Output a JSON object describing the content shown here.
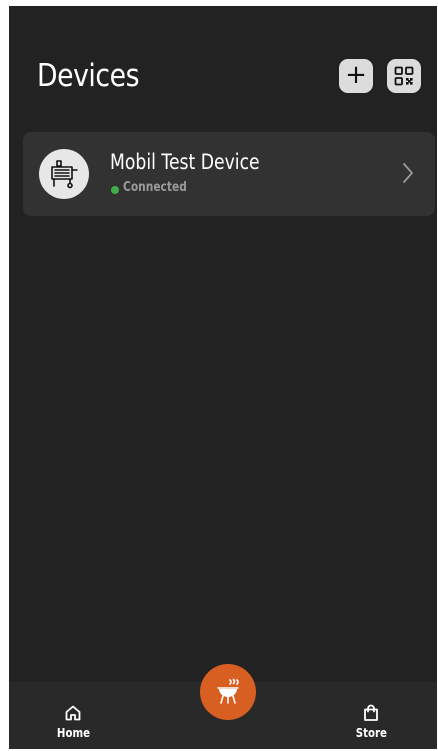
{
  "header": {
    "title": "Devices",
    "add_label": "+",
    "add_icon": "plus-icon",
    "qr_icon": "qr-code-icon"
  },
  "devices": [
    {
      "name": "Mobil Test Device",
      "status": "Connected",
      "status_color": "#3fae4a",
      "icon": "grill-device-icon"
    }
  ],
  "bottom_nav": {
    "home_label": "Home",
    "home_icon": "home-icon",
    "store_label": "Store",
    "store_icon": "shopping-bag-icon",
    "center_icon": "grill-icon"
  },
  "colors": {
    "background": "#222222",
    "card": "#323232",
    "accent": "#d85f22",
    "nav": "#292929"
  }
}
